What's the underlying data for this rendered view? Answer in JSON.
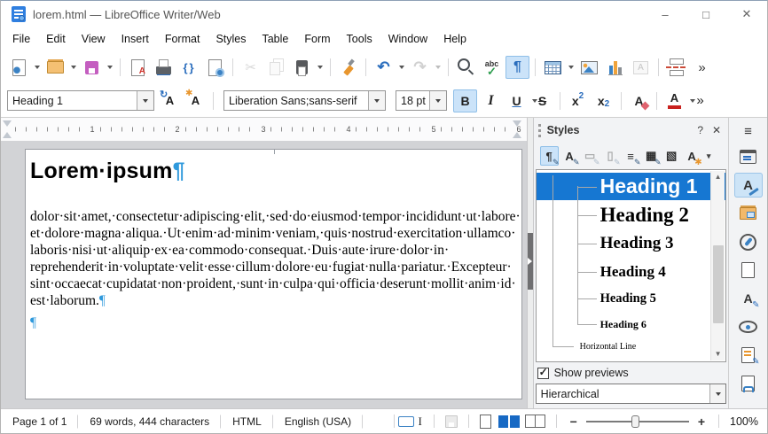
{
  "window": {
    "title": "lorem.html — LibreOffice Writer/Web",
    "controls": [
      {
        "name": "minimize-button",
        "glyph": "–",
        "interactable": true
      },
      {
        "name": "maximize-button",
        "glyph": "□",
        "interactable": true
      },
      {
        "name": "close-button",
        "glyph": "✕",
        "interactable": true
      }
    ]
  },
  "menu": {
    "items": [
      {
        "label": "File",
        "name": "menu-file"
      },
      {
        "label": "Edit",
        "name": "menu-edit"
      },
      {
        "label": "View",
        "name": "menu-view"
      },
      {
        "label": "Insert",
        "name": "menu-insert"
      },
      {
        "label": "Format",
        "name": "menu-format"
      },
      {
        "label": "Styles",
        "name": "menu-styles"
      },
      {
        "label": "Table",
        "name": "menu-table"
      },
      {
        "label": "Form",
        "name": "menu-form"
      },
      {
        "label": "Tools",
        "name": "menu-tools"
      },
      {
        "label": "Window",
        "name": "menu-window"
      },
      {
        "label": "Help",
        "name": "menu-help"
      }
    ]
  },
  "toolbar_main": {
    "items": [
      {
        "name": "new-document-button",
        "cls": "ic-new dd"
      },
      {
        "name": "open-button",
        "cls": "ic-open dd"
      },
      {
        "name": "save-button",
        "cls": "ic-save dd"
      },
      {
        "name": "separator",
        "cls": "sepi",
        "interactable": false
      },
      {
        "name": "export-pdf-button",
        "cls": "ic-pdf"
      },
      {
        "name": "print-button",
        "cls": "ic-print"
      },
      {
        "name": "html-source-button",
        "cls": "ic-code",
        "glyph": "{}"
      },
      {
        "name": "preview-in-browser-button",
        "cls": "ic-preview"
      },
      {
        "name": "separator",
        "cls": "sepi",
        "interactable": false
      },
      {
        "name": "cut-button",
        "cls": "ic-cut dis",
        "glyph": "✂"
      },
      {
        "name": "copy-button",
        "cls": "ic-copy dis"
      },
      {
        "name": "paste-button",
        "cls": "ic-paste dd"
      },
      {
        "name": "separator",
        "cls": "sepi",
        "interactable": false
      },
      {
        "name": "clone-formatting-button",
        "cls": "ic-clone"
      },
      {
        "name": "separator",
        "cls": "sepi",
        "interactable": false
      },
      {
        "name": "undo-button",
        "cls": "ic-undo dd",
        "glyph": "↶"
      },
      {
        "name": "redo-button",
        "cls": "ic-redo dd dis",
        "glyph": "↷"
      },
      {
        "name": "separator",
        "cls": "sepi",
        "interactable": false
      },
      {
        "name": "find-replace-button",
        "cls": "ic-find"
      },
      {
        "name": "spelling-button",
        "cls": "ic-spell",
        "glyph": "abc"
      },
      {
        "name": "formatting-marks-button",
        "cls": "ic-marks on",
        "glyph": "¶"
      },
      {
        "name": "separator",
        "cls": "sepi",
        "interactable": false
      },
      {
        "name": "insert-table-button",
        "cls": "ic-table dd"
      },
      {
        "name": "insert-image-button",
        "cls": "ic-image"
      },
      {
        "name": "insert-chart-button",
        "cls": "ic-chart"
      },
      {
        "name": "insert-textbox-button",
        "cls": "ic-textbox dis",
        "glyph": "A"
      },
      {
        "name": "separator",
        "cls": "sepi",
        "interactable": false
      },
      {
        "name": "insert-page-break-button",
        "cls": "ic-break"
      },
      {
        "name": "toolbar-overflow-button",
        "cls": "ic-more",
        "glyph": "»"
      }
    ]
  },
  "toolbar_format": {
    "paragraph_style": "Heading 1",
    "font_name": "Liberation Sans;sans-serif",
    "font_size": "18 pt",
    "buttons": [
      {
        "name": "bold-button",
        "glyph": "B",
        "cls": "on"
      },
      {
        "name": "italic-button",
        "glyph": "I",
        "cls": "italic"
      },
      {
        "name": "underline-button",
        "glyph": "U",
        "cls": "under dd"
      },
      {
        "name": "strikethrough-button",
        "glyph": "S",
        "cls": "strike"
      },
      {
        "name": "separator",
        "cls": "sepi",
        "interactable": false
      },
      {
        "name": "superscript-button",
        "glyph": "x",
        "glyph2": "2",
        "cls": "supb"
      },
      {
        "name": "subscript-button",
        "glyph": "x",
        "glyph2": "2",
        "cls": "subb"
      },
      {
        "name": "separator",
        "cls": "sepi",
        "interactable": false
      },
      {
        "name": "clear-formatting-button",
        "glyph": "A",
        "cls": "clearfmt"
      },
      {
        "name": "separator",
        "cls": "sepi",
        "interactable": false
      },
      {
        "name": "font-color-button",
        "glyph": "A",
        "cls": "fontcol dd"
      },
      {
        "name": "toolbar-overflow-button",
        "glyph": "»",
        "cls": "more2"
      }
    ]
  },
  "ruler": {
    "numbers": [
      {
        "label": "1",
        "cls": "rn1"
      },
      {
        "label": "2",
        "cls": "rn2"
      },
      {
        "label": "3",
        "cls": "rn3"
      },
      {
        "label": "4",
        "cls": "rn4"
      },
      {
        "label": "5",
        "cls": "rn5"
      },
      {
        "label": "6",
        "cls": "rn6"
      }
    ]
  },
  "document": {
    "heading": "Lorem ipsum",
    "body": "dolor sit amet, consectetur adipiscing elit, sed do eiusmod tempor incididunt ut labore et dolore magna aliqua. Ut enim ad minim veniam, quis nostrud exercitation ullamco laboris nisi ut aliquip ex ea commodo consequat. Duis aute irure dolor in reprehenderit in voluptate velit esse cillum dolore eu fugiat nulla pariatur. Excepteur sint occaecat cupidatat non proident, sunt in culpa qui officia deserunt mollit anim id est laborum.",
    "pilcrow": "¶"
  },
  "styles_panel": {
    "title": "Styles",
    "help_label": "?",
    "close_label": "✕",
    "toolbar": [
      {
        "name": "paragraph-styles-button",
        "glyph": "¶",
        "accent": "✎",
        "cls": "on"
      },
      {
        "name": "character-styles-button",
        "glyph": "A",
        "accent": "✎"
      },
      {
        "name": "frame-styles-button",
        "glyph": "▭",
        "accent": "✎",
        "cls": "dis"
      },
      {
        "name": "page-styles-button",
        "glyph": "▯",
        "accent": "✎",
        "cls": "dis"
      },
      {
        "name": "list-styles-button",
        "glyph": "≡",
        "accent": "✎"
      },
      {
        "name": "table-styles-button",
        "glyph": "▦",
        "accent": "✎"
      },
      {
        "name": "fill-format-mode-button",
        "glyph": "▧"
      },
      {
        "name": "new-style-from-selection-button",
        "glyph": "A",
        "accent": "✱",
        "cls": "accor"
      },
      {
        "name": "new-style-dropdown",
        "glyph": "▾",
        "cls": "ddonly"
      }
    ],
    "list": [
      {
        "label": "Heading 1",
        "cls": "s-h1",
        "name": "style-item-heading-1"
      },
      {
        "label": "Heading 2",
        "cls": "s-h2",
        "name": "style-item-heading-2"
      },
      {
        "label": "Heading 3",
        "cls": "s-h3",
        "name": "style-item-heading-3"
      },
      {
        "label": "Heading 4",
        "cls": "s-h4",
        "name": "style-item-heading-4"
      },
      {
        "label": "Heading 5",
        "cls": "s-h5",
        "name": "style-item-heading-5"
      },
      {
        "label": "Heading 6",
        "cls": "s-h6",
        "name": "style-item-heading-6"
      },
      {
        "label": "Horizontal Line",
        "cls": "s-hl",
        "name": "style-item-horizontal-line"
      }
    ],
    "show_previews_label": "Show previews",
    "filter_value": "Hierarchical"
  },
  "sidebar": {
    "settings_glyph": "≡",
    "tabs": [
      {
        "name": "sidebar-tab-properties",
        "cls": "t-props"
      },
      {
        "name": "sidebar-tab-styles",
        "cls": "t-styles on"
      },
      {
        "name": "sidebar-tab-gallery",
        "cls": "t-gallery"
      },
      {
        "name": "sidebar-tab-navigator",
        "cls": "t-nav"
      },
      {
        "name": "sidebar-tab-page",
        "cls": "t-page"
      },
      {
        "name": "sidebar-tab-style-inspector",
        "cls": "t-inspect"
      },
      {
        "name": "sidebar-tab-accessibility-check",
        "cls": "t-a11y"
      },
      {
        "name": "sidebar-tab-manage-changes",
        "cls": "t-changes"
      },
      {
        "name": "sidebar-tab-design",
        "cls": "t-design"
      }
    ]
  },
  "status_bar": {
    "segments": [
      {
        "label": "Page 1 of 1",
        "name": "status-page-count"
      },
      {
        "label": "69 words, 444 characters",
        "name": "status-word-count"
      },
      {
        "label": "HTML",
        "name": "status-doc-format"
      },
      {
        "label": "English (USA)",
        "name": "status-language"
      }
    ],
    "zoom_out": "−",
    "zoom_in": "+",
    "zoom_level": "100%"
  }
}
